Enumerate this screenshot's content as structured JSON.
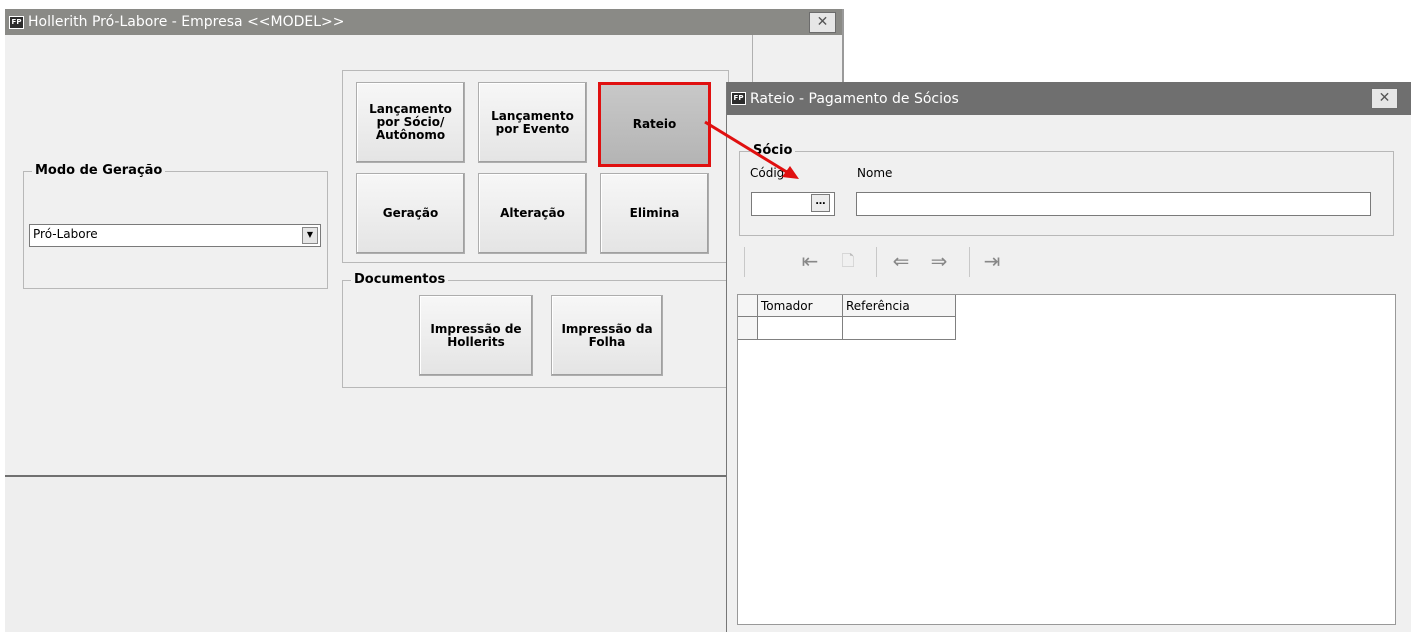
{
  "main_window": {
    "title": "Hollerith Pró-Labore - Empresa <<MODEL>>",
    "icon_text": "FP",
    "close_glyph": "✕",
    "modo_geracao": {
      "legend": "Modo de Geração",
      "selected": "Pró-Labore"
    },
    "buttons": {
      "lancamento_socio": "Lançamento\npor Sócio/\nAutônomo",
      "lancamento_evento": "Lançamento\npor Evento",
      "rateio": "Rateio",
      "geracao": "Geração",
      "alteracao": "Alteração",
      "elimina": "Elimina"
    },
    "documentos": {
      "legend": "Documentos",
      "impressao_hollerits": "Impressão de\nHollerits",
      "impressao_folha": "Impressão da\nFolha"
    }
  },
  "rateio_window": {
    "title": "Rateio - Pagamento de Sócios",
    "icon_text": "FP",
    "close_glyph": "✕",
    "socio": {
      "legend": "Sócio",
      "codigo_label": "Código",
      "nome_label": "Nome",
      "lookup_glyph": "…"
    },
    "toolbar": {
      "first": "⇤",
      "new": "🗋",
      "prev": "⇐",
      "next": "⇒",
      "last": "⇥"
    },
    "grid": {
      "columns": [
        "Tomador",
        "Referência"
      ]
    }
  },
  "colors": {
    "titlebar": "#8a8a86",
    "highlight": "#e01010",
    "window_bg": "#f0f0f0"
  }
}
